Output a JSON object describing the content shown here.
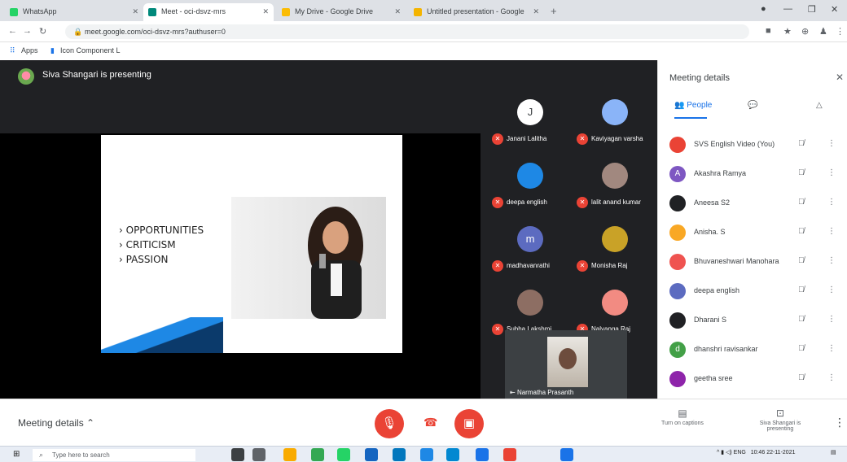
{
  "browser": {
    "tabs": [
      {
        "label": "WhatsApp",
        "color": "#25d366",
        "active": false
      },
      {
        "label": "Meet - oci-dsvz-mrs",
        "color": "#00897b",
        "active": true
      },
      {
        "label": "My Drive - Google Drive",
        "color": "#fbbc04",
        "active": false
      },
      {
        "label": "Untitled presentation - Google",
        "color": "#f4b400",
        "active": false
      }
    ],
    "url": "meet.google.com/oci-dsvz-mrs?authuser=0",
    "bookmarks": [
      "Apps",
      "Icon Component L"
    ]
  },
  "meet": {
    "presenter_text": "Siva Shangari is presenting",
    "slide": {
      "bullets": [
        "OPPORTUNITIES",
        "CRITICISM",
        "PASSION"
      ]
    },
    "tiles": [
      {
        "name": "Janani Lalitha",
        "initial": "J",
        "color": "#ffffff"
      },
      {
        "name": "Kaviyagan varsha",
        "initial": "",
        "color": "#8ab4f8"
      },
      {
        "name": "deepa english",
        "initial": "",
        "color": "#1e88e5"
      },
      {
        "name": "lalit anand kumar",
        "initial": "",
        "color": "#a1887f"
      },
      {
        "name": "madhavanrathi",
        "initial": "m",
        "color": "#5c6bc0"
      },
      {
        "name": "Monisha Raj",
        "initial": "",
        "color": "#c9a227"
      },
      {
        "name": "Subha Lakshmi",
        "initial": "",
        "color": "#8d6e63"
      },
      {
        "name": "Nalyanga Raj",
        "initial": "",
        "color": "#f28b82"
      }
    ],
    "self_label": "Narmatha Prasanth",
    "side_panel": {
      "title": "Meeting details",
      "tab_people": "People",
      "participants": [
        {
          "name": "SVS English Video (You)",
          "initial": "",
          "color": "#ea4335"
        },
        {
          "name": "Akashra Ramya",
          "initial": "A",
          "color": "#7e57c2"
        },
        {
          "name": "Aneesa S2",
          "initial": "",
          "color": "#202124"
        },
        {
          "name": "Anisha. S",
          "initial": "",
          "color": "#f9a825"
        },
        {
          "name": "Bhuvaneshwari Manohara",
          "initial": "",
          "color": "#ef5350"
        },
        {
          "name": "deepa english",
          "initial": "",
          "color": "#5c6bc0"
        },
        {
          "name": "Dharani S",
          "initial": "",
          "color": "#202124"
        },
        {
          "name": "dhanshri ravisankar",
          "initial": "d",
          "color": "#43a047"
        },
        {
          "name": "geetha sree",
          "initial": "",
          "color": "#8e24aa"
        }
      ]
    },
    "controls": {
      "details_label": "Meeting details",
      "captions_label": "Turn on captions",
      "present_label": "Siva Shangari is presenting"
    }
  },
  "taskbar": {
    "search_placeholder": "Type here to search",
    "time": "10:46",
    "date": "22-11-2021"
  }
}
